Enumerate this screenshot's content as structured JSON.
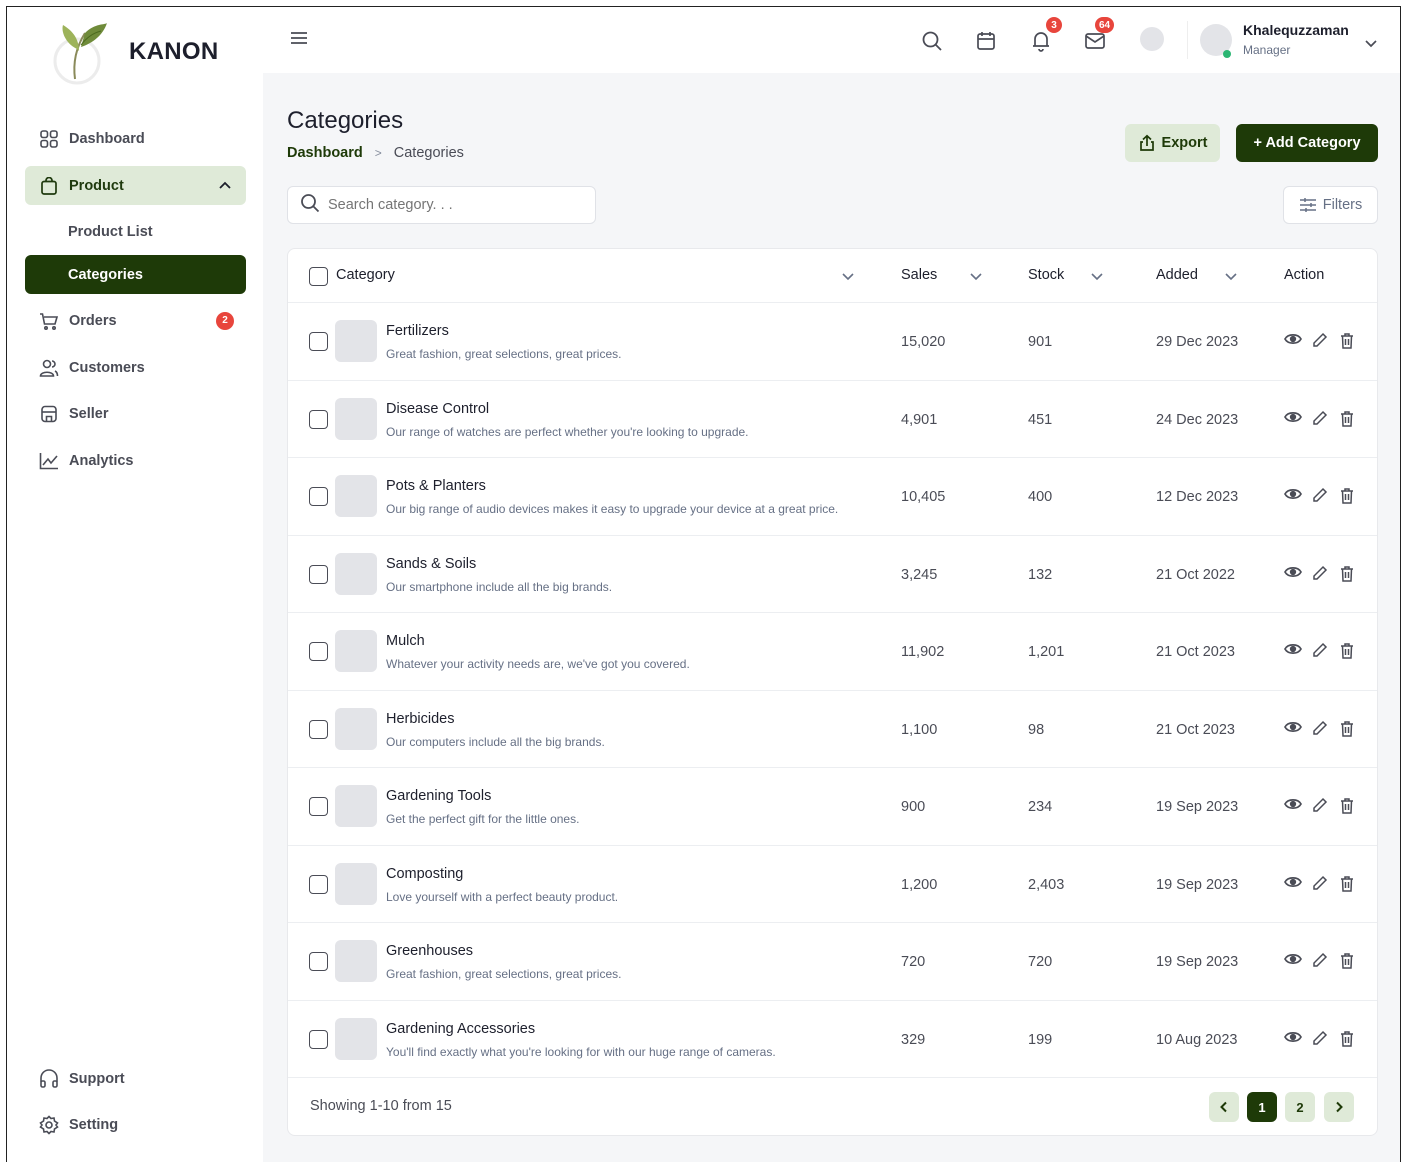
{
  "brand": {
    "name": "KANON"
  },
  "sidebar": {
    "items": [
      {
        "label": "Dashboard"
      },
      {
        "label": "Product"
      },
      {
        "label": "Product List"
      },
      {
        "label": "Categories"
      },
      {
        "label": "Orders",
        "badge": "2"
      },
      {
        "label": "Customers"
      },
      {
        "label": "Seller"
      },
      {
        "label": "Analytics"
      }
    ],
    "bottom": [
      {
        "label": "Support"
      },
      {
        "label": "Setting"
      }
    ]
  },
  "topbar": {
    "notifications_badge": "3",
    "messages_badge": "64",
    "user": {
      "name": "Khalequzzaman",
      "role": "Manager"
    }
  },
  "page": {
    "title": "Categories",
    "breadcrumb": {
      "root": "Dashboard",
      "sep": ">",
      "current": "Categories"
    },
    "export_label": "Export",
    "add_label": "+ Add Category",
    "search_placeholder": "Search category. . .",
    "filters_label": "Filters"
  },
  "table": {
    "columns": [
      "Category",
      "Sales",
      "Stock",
      "Added",
      "Action"
    ],
    "rows": [
      {
        "name": "Fertilizers",
        "desc": "Great fashion, great selections, great prices.",
        "sales": "15,020",
        "stock": "901",
        "added": "29 Dec 2023"
      },
      {
        "name": "Disease Control",
        "desc": "Our range of watches are perfect whether you're looking to upgrade.",
        "sales": "4,901",
        "stock": "451",
        "added": "24 Dec 2023"
      },
      {
        "name": "Pots & Planters",
        "desc": "Our big range of audio devices makes it easy to upgrade your device at a great price.",
        "sales": "10,405",
        "stock": "400",
        "added": "12 Dec 2023"
      },
      {
        "name": "Sands & Soils",
        "desc": "Our smartphone include all the big brands.",
        "sales": "3,245",
        "stock": "132",
        "added": "21 Oct 2022"
      },
      {
        "name": "Mulch",
        "desc": "Whatever your activity needs are, we've got you covered.",
        "sales": "11,902",
        "stock": "1,201",
        "added": "21 Oct 2023"
      },
      {
        "name": "Herbicides",
        "desc": "Our computers include all the big brands.",
        "sales": "1,100",
        "stock": "98",
        "added": "21 Oct 2023"
      },
      {
        "name": "Gardening Tools",
        "desc": "Get the perfect gift for the little ones.",
        "sales": "900",
        "stock": "234",
        "added": "19 Sep 2023"
      },
      {
        "name": "Composting",
        "desc": "Love yourself with a perfect beauty product.",
        "sales": "1,200",
        "stock": "2,403",
        "added": "19 Sep 2023"
      },
      {
        "name": "Greenhouses",
        "desc": "Great fashion, great selections, great prices.",
        "sales": "720",
        "stock": "720",
        "added": "19 Sep 2023"
      },
      {
        "name": "Gardening Accessories",
        "desc": "You'll find exactly what you're looking for with our huge range of cameras.",
        "sales": "329",
        "stock": "199",
        "added": "10 Aug 2023"
      }
    ],
    "footer": {
      "showing": "Showing 1-10 from 15",
      "pages": [
        "1",
        "2"
      ]
    }
  },
  "colors": {
    "primary": "#1e3a08",
    "primary_light": "#dfead8",
    "badge": "#e8453c",
    "online": "#2bb673"
  }
}
